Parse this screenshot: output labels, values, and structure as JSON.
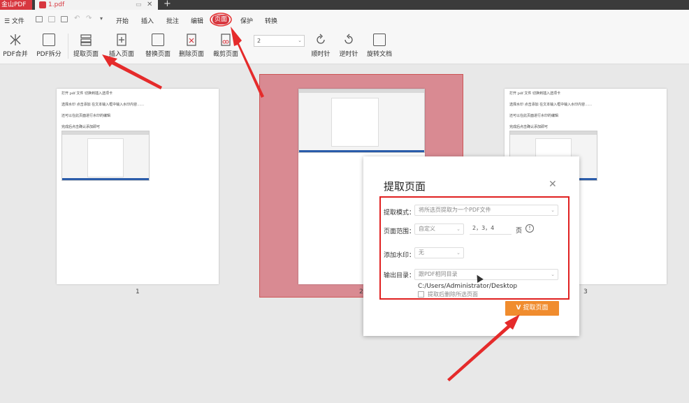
{
  "titlebar": {
    "app_name": "金山PDF",
    "doc_tab": "1.pdf",
    "new_tab": "+"
  },
  "menubar": {
    "file": "☰ 文件",
    "items": [
      "开始",
      "插入",
      "批注",
      "编辑",
      "页面",
      "保护",
      "转换"
    ]
  },
  "ribbon": {
    "buttons": [
      {
        "label": "PDF合并",
        "icon": "merge-icon"
      },
      {
        "label": "PDF拆分",
        "icon": "split-icon"
      },
      {
        "label": "提取页面",
        "icon": "extract-page-icon"
      },
      {
        "label": "插入页面",
        "icon": "insert-page-icon"
      },
      {
        "label": "替换页面",
        "icon": "replace-page-icon"
      },
      {
        "label": "删除页面",
        "icon": "delete-page-icon"
      },
      {
        "label": "裁剪页面",
        "icon": "crop-page-icon"
      },
      {
        "label": "顺时针",
        "icon": "rotate-cw-icon"
      },
      {
        "label": "逆时针",
        "icon": "rotate-ccw-icon"
      },
      {
        "label": "旋转文档",
        "icon": "rotate-doc-icon"
      }
    ],
    "page_select_value": "2"
  },
  "pages": [
    {
      "number": "1",
      "lines": [
        "打开 pdf 文件  切换到插入选项卡",
        "选择水印  点击添加  在文本输入框中输入水印内容……",
        "还可以在此页面进行水印的编辑",
        "完成后点击确认添加即可"
      ]
    },
    {
      "number": "2"
    },
    {
      "number": "3",
      "lines": [
        "打开 pdf 文件  切换到插入选项卡",
        "选择水印  点击添加  在文本输入框中输入水印内容……",
        "还可以在此页面进行水印的编辑",
        "完成后点击确认添加即可"
      ]
    }
  ],
  "dialog": {
    "title": "提取页面",
    "mode_label": "提取模式：",
    "mode_value": "将所选页提取为一个PDF文件",
    "range_label": "页面范围：",
    "range_mode": "自定义",
    "range_value": "2，3，4",
    "range_unit": "页",
    "watermark_label": "添加水印：",
    "watermark_value": "无",
    "output_label": "输出目录：",
    "output_value": "跟PDF相同目录",
    "output_path": "C:/Users/Administrator/Desktop",
    "delete_after_label": "提取后删除所选页面",
    "extract_button": "提取页面"
  },
  "colors": {
    "accent_red": "#d7373f",
    "annotation_red": "#e02020",
    "button_orange": "#f08c2e"
  }
}
